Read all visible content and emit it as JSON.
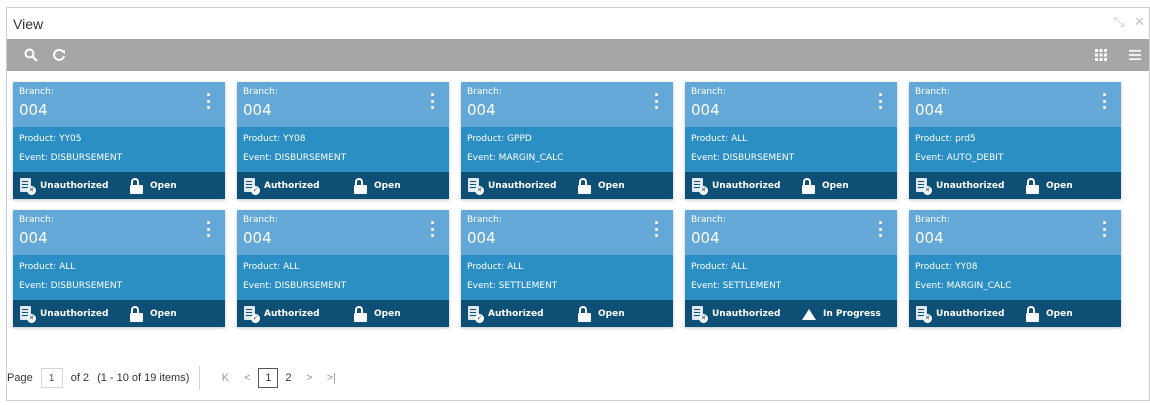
{
  "window": {
    "title": "View"
  },
  "toolbar": {
    "search_icon": "search-icon",
    "refresh_icon": "refresh-icon",
    "tile_view_icon": "grid-view-icon",
    "list_view_icon": "list-view-icon"
  },
  "cards": [
    {
      "branch_label": "Branch:",
      "branch": "004",
      "product": "Product: YY05",
      "event": "Event: DISBURSEMENT",
      "auth": "Unauthorized",
      "auth_icon": "unauthorized-icon",
      "lock": "Open",
      "lock_icon": "lock-open-icon"
    },
    {
      "branch_label": "Branch:",
      "branch": "004",
      "product": "Product: YY08",
      "event": "Event: DISBURSEMENT",
      "auth": "Authorized",
      "auth_icon": "authorized-icon",
      "lock": "Open",
      "lock_icon": "lock-open-icon"
    },
    {
      "branch_label": "Branch:",
      "branch": "004",
      "product": "Product: GPPD",
      "event": "Event: MARGIN_CALC",
      "auth": "Unauthorized",
      "auth_icon": "unauthorized-icon",
      "lock": "Open",
      "lock_icon": "lock-open-icon"
    },
    {
      "branch_label": "Branch:",
      "branch": "004",
      "product": "Product: ALL",
      "event": "Event: DISBURSEMENT",
      "auth": "Unauthorized",
      "auth_icon": "unauthorized-icon",
      "lock": "Open",
      "lock_icon": "lock-open-icon"
    },
    {
      "branch_label": "Branch:",
      "branch": "004",
      "product": "Product: prd5",
      "event": "Event: AUTO_DEBIT",
      "auth": "Unauthorized",
      "auth_icon": "unauthorized-icon",
      "lock": "Open",
      "lock_icon": "lock-open-icon"
    },
    {
      "branch_label": "Branch:",
      "branch": "004",
      "product": "Product: ALL",
      "event": "Event: DISBURSEMENT",
      "auth": "Unauthorized",
      "auth_icon": "unauthorized-icon",
      "lock": "Open",
      "lock_icon": "lock-open-icon"
    },
    {
      "branch_label": "Branch:",
      "branch": "004",
      "product": "Product: ALL",
      "event": "Event: DISBURSEMENT",
      "auth": "Authorized",
      "auth_icon": "authorized-icon",
      "lock": "Open",
      "lock_icon": "lock-open-icon"
    },
    {
      "branch_label": "Branch:",
      "branch": "004",
      "product": "Product: ALL",
      "event": "Event: SETTLEMENT",
      "auth": "Authorized",
      "auth_icon": "authorized-icon",
      "lock": "Open",
      "lock_icon": "lock-open-icon"
    },
    {
      "branch_label": "Branch:",
      "branch": "004",
      "product": "Product: ALL",
      "event": "Event: SETTLEMENT",
      "auth": "Unauthorized",
      "auth_icon": "unauthorized-icon",
      "lock": "In Progress",
      "lock_icon": "in-progress-icon"
    },
    {
      "branch_label": "Branch:",
      "branch": "004",
      "product": "Product: YY08",
      "event": "Event: MARGIN_CALC",
      "auth": "Unauthorized",
      "auth_icon": "unauthorized-icon",
      "lock": "Open",
      "lock_icon": "lock-open-icon"
    }
  ],
  "pager": {
    "page_label": "Page",
    "current_page": "1",
    "of_text": "of 2",
    "range_text": "(1 - 10 of 19 items)",
    "first_glyph": "K",
    "prev_glyph": "<",
    "pages": [
      "1",
      "2"
    ],
    "next_glyph": ">",
    "last_glyph": ">|"
  }
}
